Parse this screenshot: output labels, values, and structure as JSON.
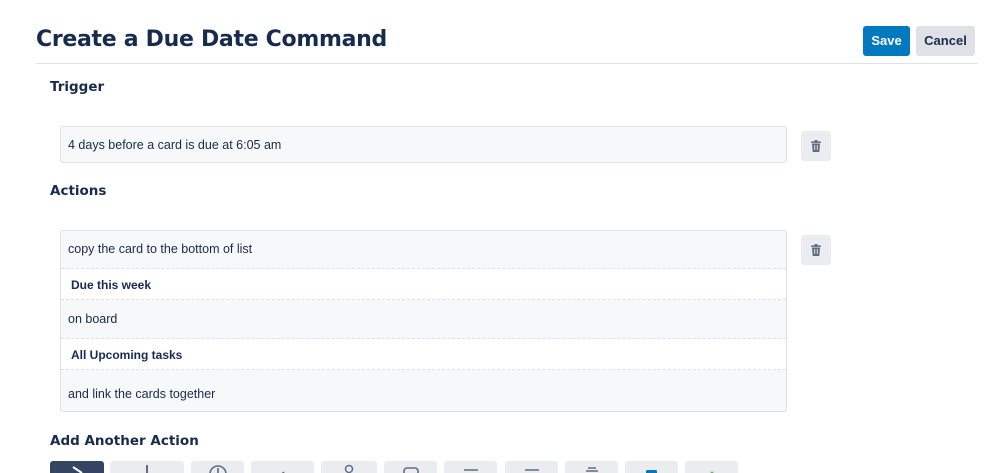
{
  "header": {
    "title": "Create a Due Date Command",
    "save_label": "Save",
    "cancel_label": "Cancel"
  },
  "trigger": {
    "heading": "Trigger",
    "text": "4 days before a card is due at 6:05 am"
  },
  "actions": {
    "heading": "Actions",
    "rows": [
      {
        "text": "copy the card to the bottom of list",
        "highlight": false
      },
      {
        "text": "Due this week",
        "highlight": true
      },
      {
        "text": "on board",
        "highlight": false
      },
      {
        "text": "All Upcoming tasks",
        "highlight": true
      },
      {
        "text": "and link the cards together",
        "highlight": false
      }
    ]
  },
  "add_action": {
    "heading": "Add Another Action"
  },
  "colors": {
    "primary": "#0079bf",
    "text": "#172b4d",
    "neutral": "#dfe1e6",
    "box_bg": "#f7f8f9",
    "active_tool": "#344563"
  },
  "toolbar_icons": [
    "move-icon",
    "plus-icon",
    "clock-icon",
    "check-icon",
    "person-icon",
    "card-icon",
    "lines-icon",
    "align-icon",
    "stack-icon",
    "checkbox-icon",
    "sparkle-icon"
  ]
}
